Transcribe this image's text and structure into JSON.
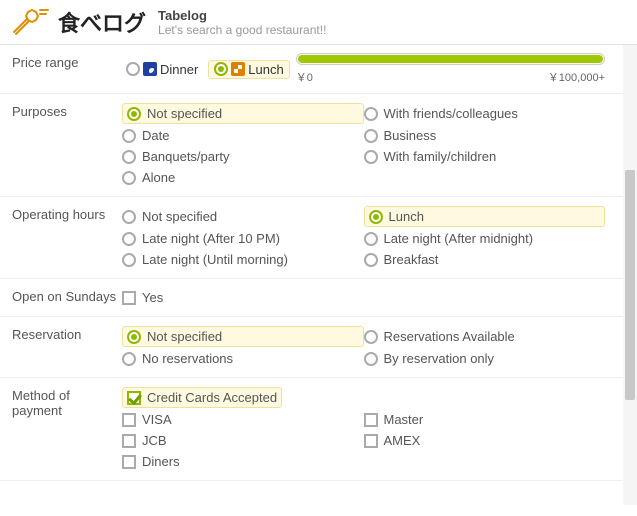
{
  "header": {
    "logo_text": "食べログ",
    "app_name": "Tabelog",
    "tagline": "Let's search a good restaurant!!"
  },
  "price": {
    "label": "Price range",
    "dinner": "Dinner",
    "lunch": "Lunch",
    "min": "￥0",
    "max": "￥100,000+"
  },
  "purposes": {
    "label": "Purposes",
    "o1": "Not specified",
    "o2": "With friends/colleagues",
    "o3": "Date",
    "o4": "Business",
    "o5": "Banquets/party",
    "o6": "With family/children",
    "o7": "Alone"
  },
  "hours": {
    "label": "Operating hours",
    "o1": "Not specified",
    "o2": "Lunch",
    "o3": "Late night (After 10 PM)",
    "o4": "Late night (After midnight)",
    "o5": "Late night (Until morning)",
    "o6": "Breakfast"
  },
  "sunday": {
    "label": "Open on Sundays",
    "yes": "Yes"
  },
  "reservation": {
    "label": "Reservation",
    "o1": "Not specified",
    "o2": "Reservations Available",
    "o3": "No reservations",
    "o4": "By reservation only"
  },
  "payment": {
    "label": "Method of payment",
    "cc": "Credit Cards Accepted",
    "visa": "VISA",
    "master": "Master",
    "jcb": "JCB",
    "amex": "AMEX",
    "diners": "Diners"
  }
}
